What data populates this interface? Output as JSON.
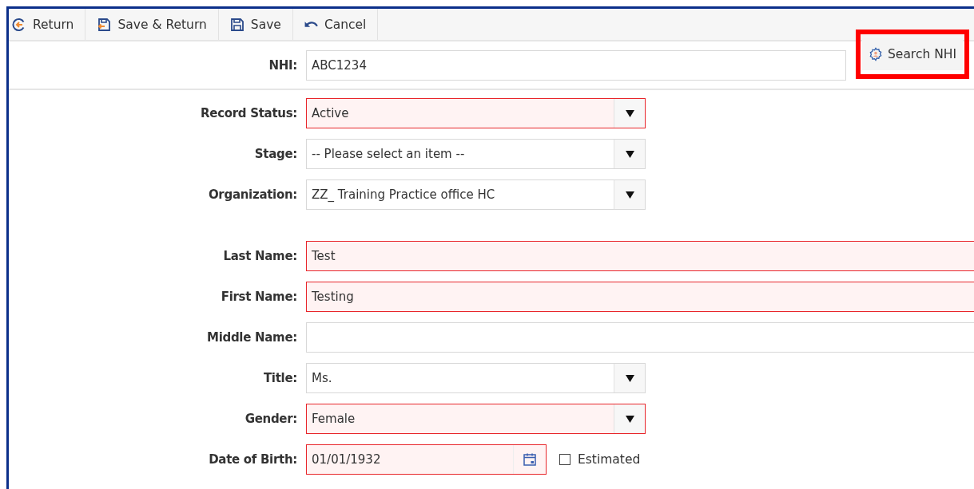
{
  "toolbar": [
    {
      "label": "Return"
    },
    {
      "label": "Save & Return"
    },
    {
      "label": "Save"
    },
    {
      "label": "Cancel"
    }
  ],
  "nhi": {
    "label": "NHI:",
    "value": "ABC1234",
    "button": "Search NHI",
    "highlighted": true
  },
  "groups": [
    [
      {
        "label": "Record Status:",
        "kind": "select",
        "value": "Active",
        "required": true
      },
      {
        "label": "Stage:",
        "kind": "select",
        "value": "-- Please select an item --",
        "required": false
      },
      {
        "label": "Organization:",
        "kind": "select",
        "value": "ZZ_ Training Practice office HC",
        "required": false
      }
    ],
    [
      {
        "label": "Last Name:",
        "kind": "text",
        "value": "Test",
        "required": true
      },
      {
        "label": "First Name:",
        "kind": "text",
        "value": "Testing",
        "required": true
      },
      {
        "label": "Middle Name:",
        "kind": "text",
        "required": false
      },
      {
        "label": "Title:",
        "kind": "select",
        "value": "Ms.",
        "required": false
      },
      {
        "label": "Gender:",
        "kind": "select",
        "value": "Female",
        "required": true
      },
      {
        "label": "Date of Birth:",
        "kind": "date",
        "value": "01/01/1932",
        "required": true,
        "checkbox": {
          "label": "Estimated",
          "checked": false
        }
      }
    ]
  ]
}
